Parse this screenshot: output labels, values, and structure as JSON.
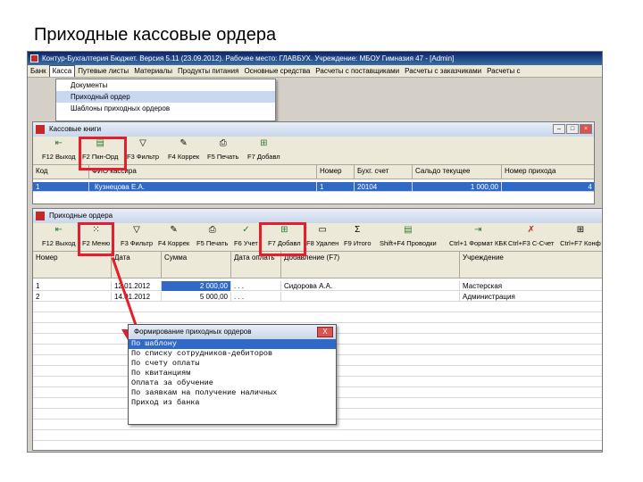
{
  "slide": {
    "title": "Приходные кассовые ордера"
  },
  "app": {
    "title": "Контур-Бухгалтерия Бюджет. Версия 5.11 (23.09.2012). Рабочее место: ГЛАВБУХ. Учреждение: МБОУ Гимназия 47 - [Admin]",
    "menu": [
      "Банк",
      "Касса",
      "Путевые листы",
      "Материалы",
      "Продукты питания",
      "Основные средства",
      "Расчеты с поставщиками",
      "Расчеты с заказчиками",
      "Расчеты с"
    ],
    "dropdown": [
      "Документы",
      "Приходный ордер",
      "Шаблоны приходных ордеров"
    ]
  },
  "cashbooks": {
    "title": "Кассовые книги",
    "toolbar": [
      {
        "icon": "exit-icon",
        "label": "F12 Выход"
      },
      {
        "icon": "cash-order-icon",
        "label": "F2 Пкн-Орд"
      },
      {
        "icon": "filter-icon",
        "label": "F3 Фильтр"
      },
      {
        "icon": "correct-icon",
        "label": "F4 Коррек"
      },
      {
        "icon": "print-icon",
        "label": "F5 Печать"
      },
      {
        "icon": "add-icon",
        "label": "F7 Добавл"
      }
    ],
    "columns": [
      "Код",
      "ФИО кассира",
      "Номер",
      "Бухг. счет",
      "Сальдо текущее",
      "Номер прихода"
    ],
    "rows": [
      [
        "1",
        "Кузнецова Е.А.",
        "1",
        "20104",
        "1 000,00",
        "4"
      ]
    ]
  },
  "orders": {
    "title": "Приходные ордера",
    "toolbar": [
      {
        "icon": "exit-icon",
        "label": "F12 Выход"
      },
      {
        "icon": "menu-icon",
        "label": "F2 Меню"
      },
      {
        "icon": "filter-icon",
        "label": "F3 Фильтр"
      },
      {
        "icon": "correct-icon",
        "label": "F4 Коррек"
      },
      {
        "icon": "print-icon",
        "label": "F5 Печать"
      },
      {
        "icon": "check-icon",
        "label": "F6 Учет"
      },
      {
        "icon": "add-icon",
        "label": "F7 Добавл"
      },
      {
        "icon": "delete-icon",
        "label": "F8 Удален"
      },
      {
        "icon": "sum-icon",
        "label": "F9 Итого"
      },
      {
        "icon": "posting-icon",
        "label": "Shift+F4 Проводки"
      },
      {
        "icon": "export-icon",
        "label": "Ctrl+1 Формат КБК"
      },
      {
        "icon": "account-icon",
        "label": "Ctrl+F3 С-Счет"
      },
      {
        "icon": "config-icon",
        "label": "Ctrl+F7 Конф"
      }
    ],
    "add_tooltip": "Добавление (F7)",
    "columns": [
      "Номер",
      "Дата",
      "Сумма",
      "Дата оплать",
      "Учреждение"
    ],
    "rows": [
      [
        "1",
        "12.01.2012",
        "2 000,00",
        ". . .",
        "Сидорова А.А.",
        "Мастерская"
      ],
      [
        "2",
        "14.01.2012",
        "5 000,00",
        ". . .",
        "",
        "Администрация"
      ]
    ]
  },
  "popup": {
    "title": "Формирование приходных ордеров",
    "close": "X",
    "items": [
      "По шаблону",
      "По списку сотрудников-дебиторов",
      "По счету оплаты",
      "По квитанциям",
      "Оплата за обучение",
      "По заявкам на получение наличных",
      "Приход из банка"
    ]
  }
}
